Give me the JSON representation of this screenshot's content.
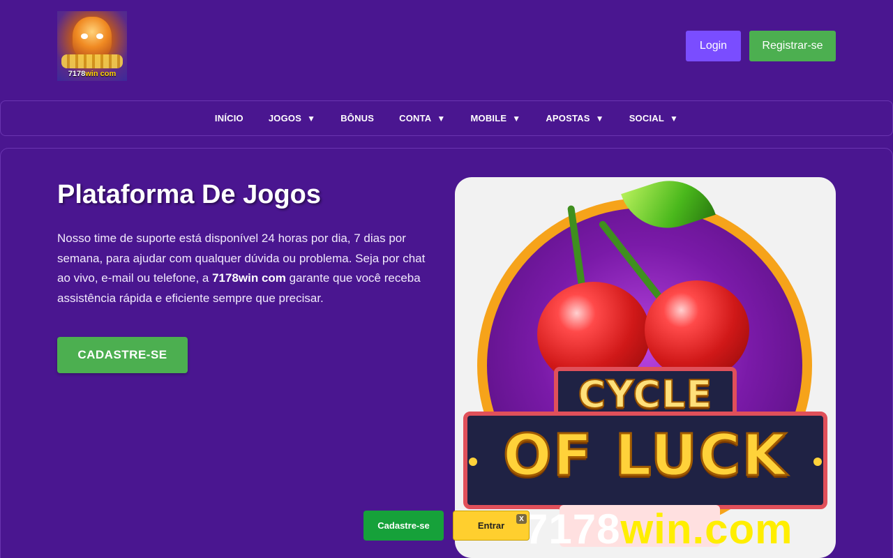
{
  "header": {
    "logo": {
      "text_part1": "7178",
      "text_part2": "win com",
      "icon": "tiger-mascot-logo"
    },
    "login_label": "Login",
    "register_label": "Registrar-se"
  },
  "nav": {
    "items": [
      {
        "label": "INÍCIO",
        "has_dropdown": false
      },
      {
        "label": "JOGOS",
        "has_dropdown": true
      },
      {
        "label": "BÔNUS",
        "has_dropdown": false
      },
      {
        "label": "CONTA",
        "has_dropdown": true
      },
      {
        "label": "MOBILE",
        "has_dropdown": true
      },
      {
        "label": "APOSTAS",
        "has_dropdown": true
      },
      {
        "label": "SOCIAL",
        "has_dropdown": true
      }
    ],
    "caret": "▼"
  },
  "hero": {
    "title": "Plataforma De Jogos",
    "text_before": "Nosso time de suporte está disponível 24 horas por dia, 7 dias por semana, para ajudar com qualquer dúvida ou problema. Seja por chat ao vivo, e-mail ou telefone, a ",
    "text_brand": "7178win com",
    "text_after": " garante que você receba assistência rápida e eficiente sempre que precisar.",
    "cta_label": "CADASTRE-SE"
  },
  "game_image": {
    "line1": "CYCLE",
    "line2": "OF LUCK",
    "icon": "cherry-slot-game-art"
  },
  "watermark": {
    "part1": "7178",
    "part2": "win.com"
  },
  "floating_bar": {
    "signup_label": "Cadastre-se",
    "login_label": "Entrar",
    "close_label": "X"
  },
  "colors": {
    "background": "#4a1690",
    "login_button": "#7a4dff",
    "register_button": "#4caf50",
    "float_signup": "#16a13a",
    "float_login": "#ffcf2e"
  }
}
